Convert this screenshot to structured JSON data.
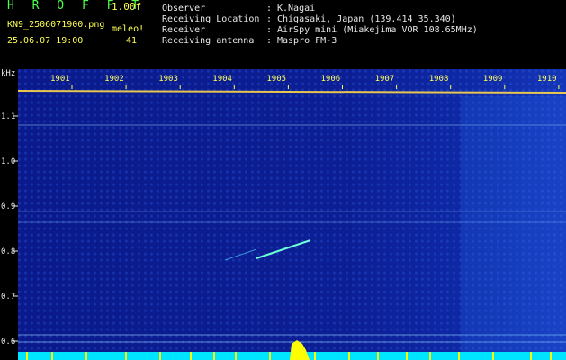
{
  "header": {
    "brand": "H R O F F T",
    "version": "1.00f",
    "filename": "KN9_2506071900.png",
    "mode": "meleo!",
    "datetime": "25.06.07 19:00",
    "count": "41",
    "info": [
      {
        "label": "Observer",
        "value": "K.Nagai"
      },
      {
        "label": "Receiving Location",
        "value": "Chigasaki, Japan (139.414 35.340)"
      },
      {
        "label": "Receiver",
        "value": "AirSpy mini (Miakejima VOR 108.65MHz)"
      },
      {
        "label": "Receiving antenna",
        "value": "Maspro FM-3"
      }
    ]
  },
  "chart_data": {
    "type": "heatmap",
    "ylabel": "kHz",
    "y_ticks": [
      "1.1",
      "1.0",
      "0.9",
      "0.8",
      "0.7",
      "0.6"
    ],
    "x_ticks": [
      "1901",
      "1902",
      "1903",
      "1904",
      "1905",
      "1906",
      "1907",
      "1908",
      "1909",
      "1910"
    ],
    "colors": {
      "background": "#0c1e94",
      "signal": "#ffff00",
      "noise": "#3fa0ff",
      "baseline": "#00e5ff"
    }
  }
}
